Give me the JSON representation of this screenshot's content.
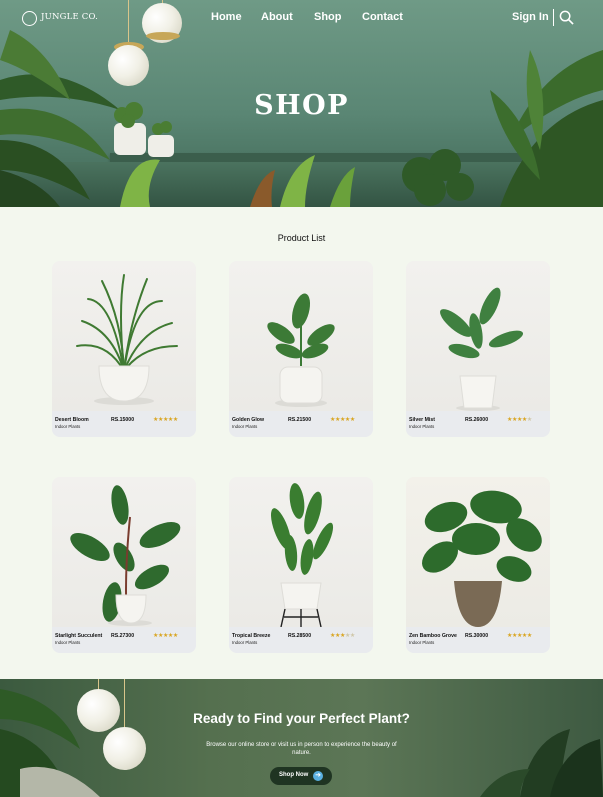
{
  "header": {
    "brand": "JUNGLE CO.",
    "logo_icon": "leaf-logo-icon",
    "nav": [
      {
        "label": "Home"
      },
      {
        "label": "About"
      },
      {
        "label": "Shop"
      },
      {
        "label": "Contact"
      }
    ],
    "sign_in": "Sign In",
    "search_icon": "search-icon"
  },
  "hero": {
    "title": "SHOP"
  },
  "products": {
    "title": "Product List",
    "items": [
      {
        "name": "Desert Bloom",
        "category": "Indoor Plants",
        "price": "RS.15000",
        "rating": 5
      },
      {
        "name": "Golden Glow",
        "category": "Indoor Plants",
        "price": "RS.21500",
        "rating": 5
      },
      {
        "name": "Silver Mist",
        "category": "Indoor Plants",
        "price": "RS.26000",
        "rating": 4
      },
      {
        "name": "Starlight Succulent",
        "category": "Indoor Plants",
        "price": "RS.27300",
        "rating": 5
      },
      {
        "name": "Tropical Breeze",
        "category": "Indoor Plants",
        "price": "RS.28500",
        "rating": 3
      },
      {
        "name": "Zen Bamboo Grove",
        "category": "Indoor Plants",
        "price": "RS.30000",
        "rating": 5
      }
    ]
  },
  "cta": {
    "title": "Ready to Find your Perfect Plant?",
    "subtitle": "Browse our online store or visit us in person to experience the beauty of nature.",
    "button": "Shop Now",
    "button_icon": "arrow-right-icon"
  },
  "colors": {
    "page_bg": "#f3f7ee",
    "hero_green": "#5a8674",
    "cta_button": "#1f3422",
    "star": "#d9a521"
  }
}
